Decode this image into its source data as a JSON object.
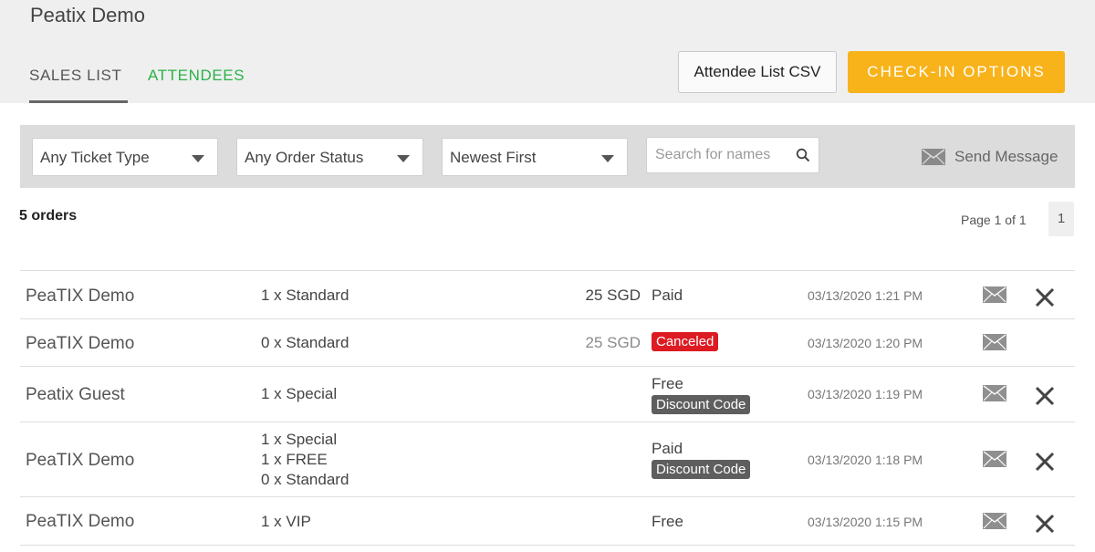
{
  "event": {
    "title": "Peatix Demo"
  },
  "tabs": [
    {
      "label": "SALES LIST",
      "active": true
    },
    {
      "label": "ATTENDEES",
      "active": false
    }
  ],
  "toolbar": {
    "csv_label": "Attendee List CSV",
    "checkin_label": "CHECK-IN OPTIONS"
  },
  "filters": {
    "ticket_type": "Any Ticket Type",
    "order_status": "Any Order Status",
    "sort": "Newest First",
    "search_placeholder": "Search for names",
    "send_message": "Send Message"
  },
  "summary": {
    "order_count": "5 orders",
    "page_info": "Page 1 of 1",
    "current_page": "1"
  },
  "orders": [
    {
      "buyer": "PeaTIX Demo",
      "items": [
        "1 x Standard"
      ],
      "amount": "25 SGD",
      "status": "Paid",
      "badge": "",
      "date": "03/13/2020 1:21 PM"
    },
    {
      "buyer": "PeaTIX Demo",
      "items": [
        "0 x Standard"
      ],
      "amount": "25 SGD",
      "status": "",
      "badge": "Canceled",
      "date": "03/13/2020 1:20 PM"
    },
    {
      "buyer": "Peatix Guest",
      "items": [
        "1 x Special"
      ],
      "amount": "",
      "status": "Free",
      "badge": "Discount Code",
      "date": "03/13/2020 1:19 PM"
    },
    {
      "buyer": "PeaTIX Demo",
      "items": [
        "1 x Special",
        "1 x FREE",
        "0 x Standard"
      ],
      "amount": "",
      "status": "Paid",
      "badge": "Discount Code",
      "date": "03/13/2020 1:18 PM"
    },
    {
      "buyer": "PeaTIX Demo",
      "items": [
        "1 x VIP"
      ],
      "amount": "",
      "status": "Free",
      "badge": "",
      "date": "03/13/2020 1:15 PM"
    }
  ],
  "colors": {
    "accent_green": "#2ab24a",
    "checkin_orange": "#f8b31b",
    "canceled_red": "#dd1b22",
    "badge_grey": "#5e5e5e"
  },
  "icons": [
    "dropdown-caret-icon",
    "search-icon",
    "mail-icon",
    "close-icon"
  ]
}
